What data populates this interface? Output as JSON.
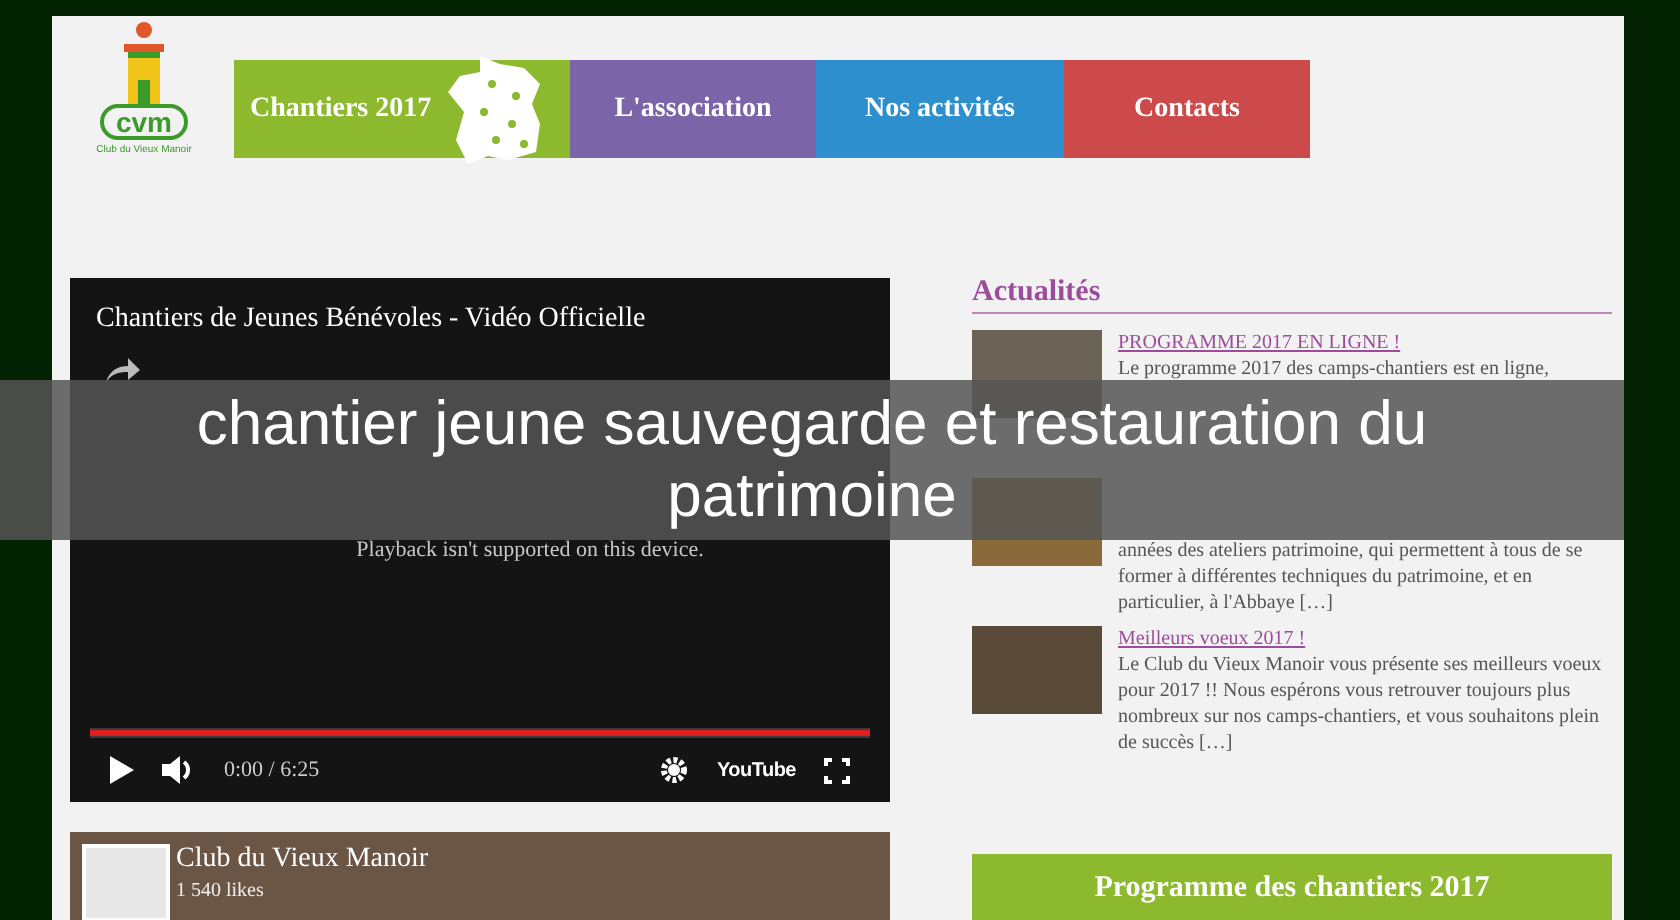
{
  "logo": {
    "initials": "cvm",
    "caption": "Club du Vieux Manoir"
  },
  "nav": [
    {
      "label": "Chantiers 2017",
      "color": "#8db92e"
    },
    {
      "label": "L'association",
      "color": "#7c64a8"
    },
    {
      "label": "Nos activités",
      "color": "#2e8fcf"
    },
    {
      "label": "Contacts",
      "color": "#cc4a4a"
    }
  ],
  "video": {
    "title": "Chantiers de Jeunes Bénévoles - Vidéo Officielle",
    "message": "Playback isn't supported on this device.",
    "time": "0:00 / 6:25",
    "logo": "YouTube",
    "level": 1
  },
  "facebook": {
    "name": "Club du Vieux Manoir",
    "likes": "1 540 likes"
  },
  "news": {
    "heading": "Actualités",
    "items": [
      {
        "title": "PROGRAMME 2017 EN LIGNE !",
        "body": "Le programme 2017 des camps-chantiers est en ligne,"
      },
      {
        "body": "années des ateliers patrimoine, qui permettent à tous de se former à différentes techniques du patrimoine, et en particulier, à l'Abbaye […]"
      },
      {
        "title": "Meilleurs voeux 2017 !",
        "body": "Le Club du Vieux Manoir vous présente ses meilleurs voeux pour 2017 !! Nous espérons vous retrouver toujours plus nombreux sur nos camps-chantiers, et vous souhaitons plein de succès […]"
      }
    ]
  },
  "program_button": "Programme des chantiers 2017",
  "overlay_caption": "chantier jeune sauvegarde et restauration du patrimoine"
}
